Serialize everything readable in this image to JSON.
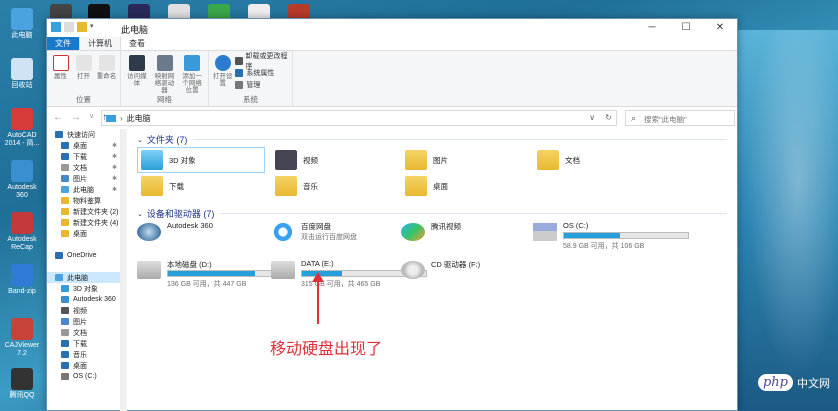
{
  "desktop": {
    "icons": [
      {
        "label": "此电脑",
        "color": "#4aa3e0"
      },
      {
        "label": "回收站",
        "color": "#cfe3f5"
      },
      {
        "label": "AutoCAD 2014 - 简...",
        "color": "#d83a3a"
      },
      {
        "label": "Autodesk 360",
        "color": "#3a8fd0"
      },
      {
        "label": "Autodesk ReCap",
        "color": "#c43a3a"
      },
      {
        "label": "Band-zip",
        "color": "#2f7bd6"
      },
      {
        "label": "CAJViewer 7.2",
        "color": "#c8423a"
      },
      {
        "label": "腾讯QQ",
        "color": "#333333"
      }
    ]
  },
  "window": {
    "title": "此电脑",
    "minimize": "─",
    "maximize": "☐",
    "close": "✕",
    "tabs": [
      {
        "label": "文件"
      },
      {
        "label": "计算机"
      },
      {
        "label": "查看"
      }
    ],
    "ribbon": {
      "location_group": {
        "label": "位置",
        "buttons": [
          {
            "label": "属性",
            "color": "#c33"
          },
          {
            "label": "打开",
            "color": "#ccc"
          },
          {
            "label": "重命名",
            "color": "#ccc"
          }
        ]
      },
      "network_group": {
        "label": "网络",
        "buttons": [
          {
            "label": "访问媒体",
            "color": "#333"
          },
          {
            "label": "映射网络驱动器",
            "color": "#2b6fb3"
          },
          {
            "label": "添加一个网络位置",
            "color": "#2b6fb3"
          }
        ]
      },
      "system_group": {
        "label": "系统",
        "open_settings": "打开设置",
        "rows": [
          {
            "label": "卸载或更改程序",
            "color": "#444"
          },
          {
            "label": "系统属性",
            "color": "#2b6fb3"
          },
          {
            "label": "管理",
            "color": "#555"
          }
        ]
      }
    },
    "address": {
      "path": "此电脑",
      "back": "←",
      "forward": "→",
      "recent": "∨",
      "up": "↑",
      "refresh": "↻",
      "dropdown": "∨",
      "search_placeholder": "搜索\"此电脑\""
    },
    "navpane": {
      "items": [
        {
          "label": "快速访问",
          "color": "#2b6fb3",
          "pinned": false
        },
        {
          "label": "桌面",
          "color": "#2b6fb3",
          "pinned": true
        },
        {
          "label": "下载",
          "color": "#2b6fb3",
          "pinned": true
        },
        {
          "label": "文档",
          "color": "#999999",
          "pinned": true
        },
        {
          "label": "图片",
          "color": "#4a86c8",
          "pinned": true
        },
        {
          "label": "此电脑",
          "color": "#4aa3e0",
          "pinned": true
        },
        {
          "label": "物料鉴算",
          "color": "#e8b830",
          "pinned": false
        },
        {
          "label": "新建文件夹 (2)",
          "color": "#e8b830",
          "pinned": false
        },
        {
          "label": "新建文件夹 (4)",
          "color": "#e8b830",
          "pinned": false
        },
        {
          "label": "桌面",
          "color": "#e8b830",
          "pinned": false
        },
        {
          "label": "",
          "color": "transparent",
          "pinned": false
        },
        {
          "label": "OneDrive",
          "color": "#2b6fb3",
          "pinned": false
        },
        {
          "label": "",
          "color": "transparent",
          "pinned": false
        },
        {
          "label": "此电脑",
          "color": "#4aa3e0",
          "pinned": false
        },
        {
          "label": "3D 对象",
          "color": "#3a9ad9",
          "pinned": false
        },
        {
          "label": "Autodesk 360",
          "color": "#3a8fd0",
          "pinned": false
        },
        {
          "label": "视频",
          "color": "#555555",
          "pinned": false
        },
        {
          "label": "图片",
          "color": "#4a86c8",
          "pinned": false
        },
        {
          "label": "文档",
          "color": "#999999",
          "pinned": false
        },
        {
          "label": "下载",
          "color": "#2b6fb3",
          "pinned": false
        },
        {
          "label": "音乐",
          "color": "#2b6fb3",
          "pinned": false
        },
        {
          "label": "桌面",
          "color": "#2b6fb3",
          "pinned": false
        },
        {
          "label": "OS (C:)",
          "color": "#777777",
          "pinned": false
        }
      ]
    },
    "folders_section": {
      "title": "文件夹 (7)",
      "items": [
        {
          "label": "3D 对象"
        },
        {
          "label": "视频"
        },
        {
          "label": "图片"
        },
        {
          "label": "文档"
        },
        {
          "label": "下载"
        },
        {
          "label": "音乐"
        },
        {
          "label": "桌面"
        }
      ]
    },
    "drives_section": {
      "title": "设备和驱动器 (7)",
      "items": [
        {
          "name": "Autodesk 360",
          "usage": null,
          "detail": ""
        },
        {
          "name": "百度网盘",
          "usage": null,
          "detail": "双击运行百度网盘"
        },
        {
          "name": "腾讯视频",
          "usage": null,
          "detail": ""
        },
        {
          "name": "OS (C:)",
          "usage": 0.45,
          "detail": "58.9 GB 可用，共 106 GB"
        },
        {
          "name": "本地磁盘 (D:)",
          "usage": 0.7,
          "detail": "136 GB 可用，共 447 GB"
        },
        {
          "name": "DATA (E:)",
          "usage": 0.32,
          "detail": "315 GB 可用，共 465 GB"
        },
        {
          "name": "CD 驱动器 (F:)",
          "usage": null,
          "detail": ""
        }
      ]
    }
  },
  "annotation": "移动硬盘出现了",
  "watermark": {
    "logo": "php",
    "text": "中文网"
  }
}
